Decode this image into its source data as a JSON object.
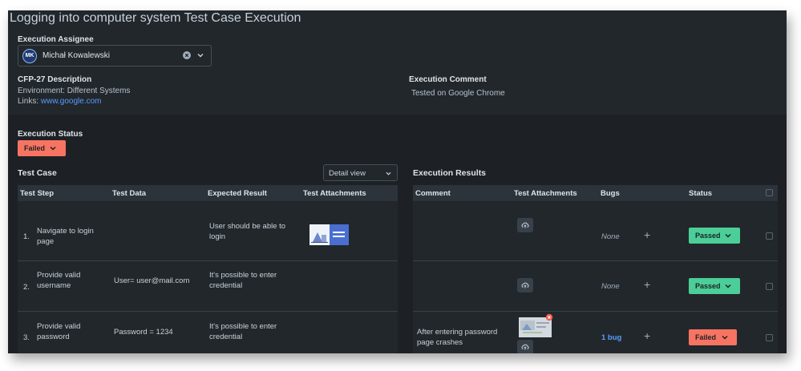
{
  "page": {
    "title": "Logging into computer system Test Case Execution"
  },
  "assignee": {
    "label": "Execution Assignee",
    "initials": "MK",
    "name": "Michał Kowalewski"
  },
  "description": {
    "heading": "CFP-27 Description",
    "environment": "Environment: Different Systems",
    "links_prefix": "Links:",
    "link_text": "www.google.com"
  },
  "comment": {
    "heading": "Execution Comment",
    "text": "Tested on Google Chrome"
  },
  "execution_status": {
    "label": "Execution Status",
    "value": "Failed"
  },
  "test_case": {
    "heading": "Test Case",
    "view_select": "Detail view",
    "columns": [
      "Test Step",
      "Test Data",
      "Expected Result",
      "Test Attachments"
    ],
    "rows": [
      {
        "num": "1.",
        "step": [
          "Navigate to login",
          "page"
        ],
        "data": "",
        "expected": [
          "User should be able to",
          "login"
        ]
      },
      {
        "num": "2.",
        "step": [
          "Provide valid",
          "username"
        ],
        "data": "User= user@mail.com",
        "expected": [
          "It's possible to enter",
          "credential"
        ]
      },
      {
        "num": "3.",
        "step": [
          "Provide valid",
          "password"
        ],
        "data": "Password = 1234",
        "expected": [
          "It's possible to enter",
          "credential"
        ]
      }
    ]
  },
  "results": {
    "heading": "Execution Results",
    "columns": [
      "Comment",
      "Test Attachments",
      "Bugs",
      "Status"
    ],
    "rows": [
      {
        "comment": [
          "",
          ""
        ],
        "bugs": "None",
        "status": "Passed"
      },
      {
        "comment": [
          "",
          ""
        ],
        "bugs": "None",
        "status": "Passed"
      },
      {
        "comment": [
          "After entering password",
          "page crashes"
        ],
        "bugs": "1 bug",
        "status": "Failed"
      }
    ]
  },
  "colors": {
    "failed": "#f87462",
    "passed": "#4bce97",
    "link": "#579dff",
    "background": "#1d2125"
  },
  "icons": [
    "clear-icon",
    "chevron-down-icon",
    "upload-cloud-icon",
    "plus-icon",
    "remove-icon",
    "checkbox-icon"
  ]
}
